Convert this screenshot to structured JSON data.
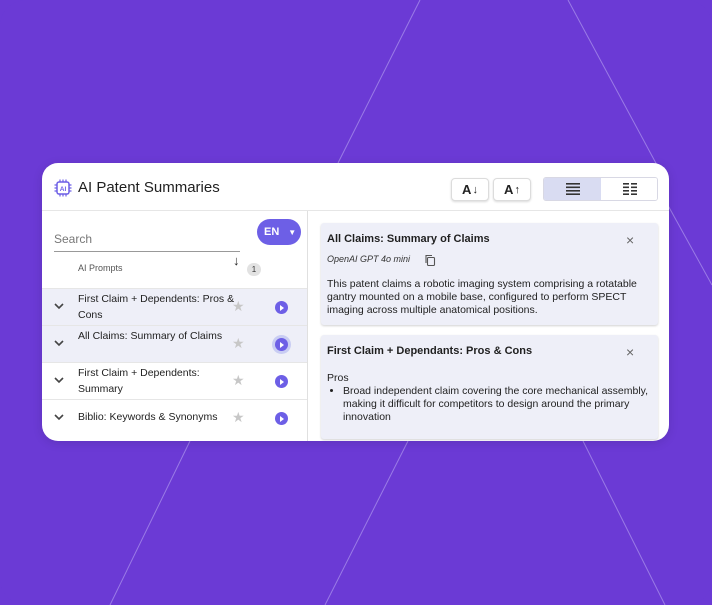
{
  "header": {
    "title": "AI Patent Summaries",
    "logo_text": "AI",
    "font_decrease_label": "A",
    "font_increase_label": "A"
  },
  "search": {
    "placeholder": "Search"
  },
  "language": {
    "label": "EN"
  },
  "list": {
    "column_label": "AI Prompts",
    "sort_count": "1",
    "items": [
      {
        "label": "First Claim + Dependents: Pros & Cons",
        "selected": true
      },
      {
        "label": "All Claims: Summary of Claims",
        "selected": true
      },
      {
        "label": "First Claim + Dependents: Summary",
        "selected": false
      },
      {
        "label": "Biblio: Keywords & Synonyms",
        "selected": false
      }
    ]
  },
  "summaries": [
    {
      "title": "All Claims: Summary of Claims",
      "model": "OpenAI GPT 4o mini",
      "body": "This patent claims a robotic imaging system comprising a rotatable gantry mounted on a mobile base, configured to perform SPECT imaging across multiple anatomical positions."
    },
    {
      "title": "First Claim + Dependants: Pros & Cons",
      "section": "Pros",
      "bullets": [
        "Broad independent claim covering the core mechanical assembly, making it difficult for competitors to design around the primary innovation"
      ]
    }
  ],
  "colors": {
    "background": "#6b3ad5",
    "accent": "#6d5fe6",
    "card_bg": "#eeeff8"
  }
}
